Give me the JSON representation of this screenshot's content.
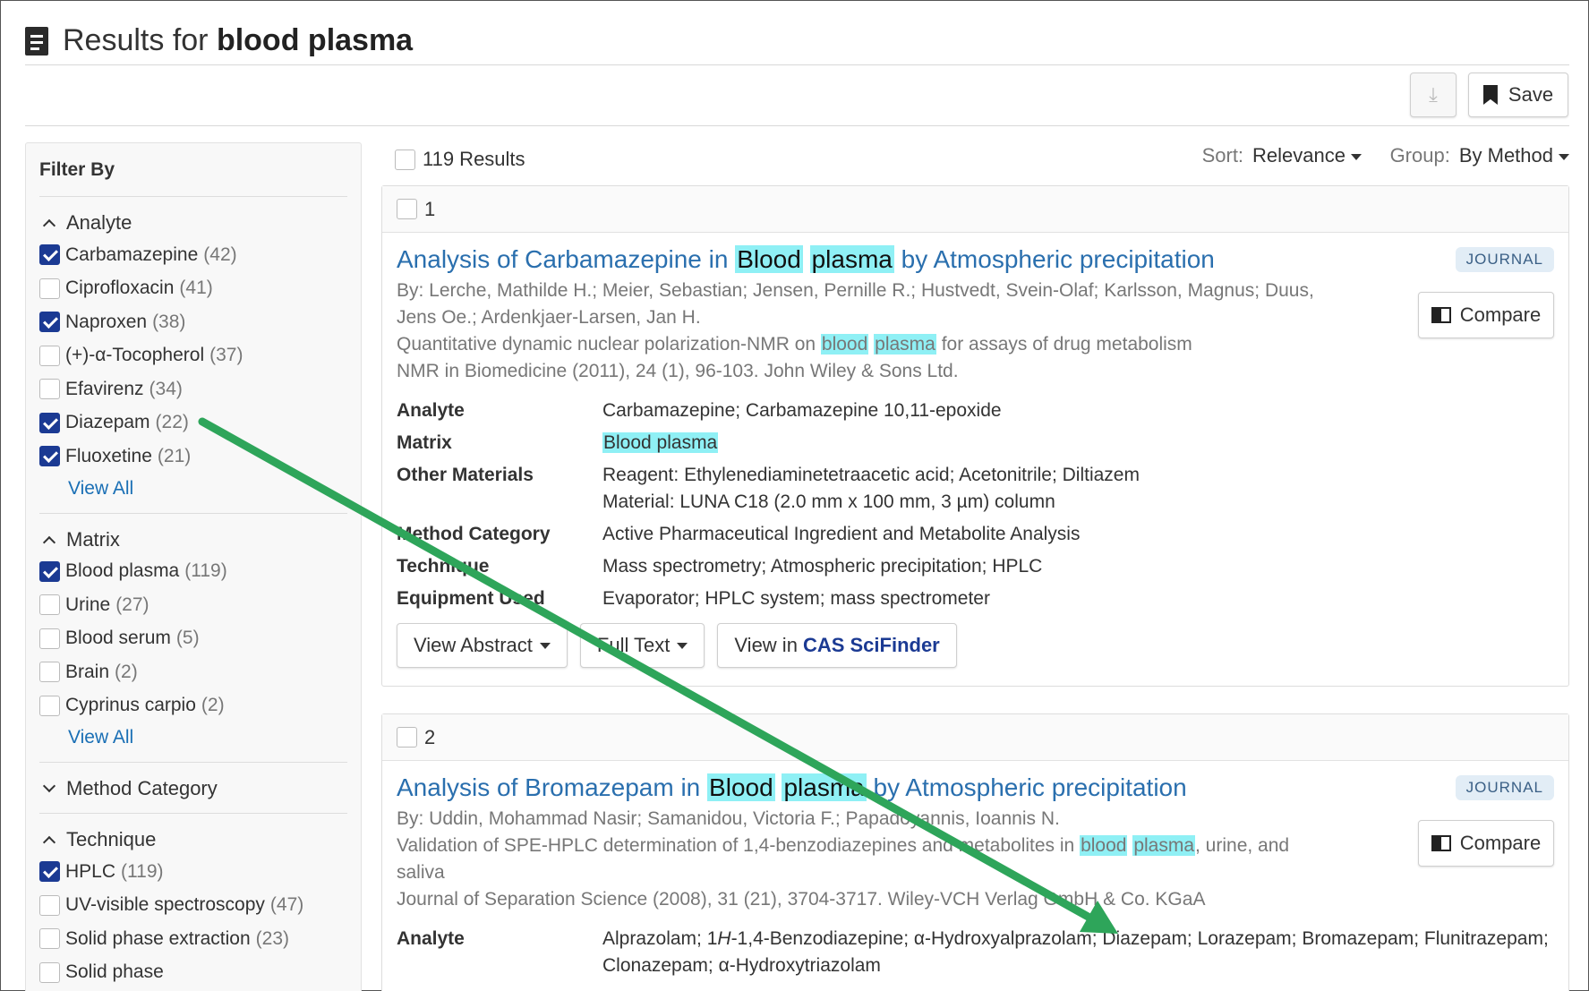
{
  "header": {
    "title_prefix": "Results for",
    "query": "blood plasma"
  },
  "toolbar": {
    "download_icon": "download-icon",
    "save_label": "Save"
  },
  "filter": {
    "title": "Filter By",
    "view_all_label": "View All",
    "analyte": {
      "label": "Analyte",
      "items": [
        {
          "name": "Carbamazepine",
          "count": "(42)",
          "checked": true
        },
        {
          "name": "Ciprofloxacin",
          "count": "(41)",
          "checked": false
        },
        {
          "name": "Naproxen",
          "count": "(38)",
          "checked": true
        },
        {
          "name": "(+)-α-Tocopherol",
          "count": "(37)",
          "checked": false
        },
        {
          "name": "Efavirenz",
          "count": "(34)",
          "checked": false
        },
        {
          "name": "Diazepam",
          "count": "(22)",
          "checked": true
        },
        {
          "name": "Fluoxetine",
          "count": "(21)",
          "checked": true
        }
      ]
    },
    "matrix": {
      "label": "Matrix",
      "items": [
        {
          "name": "Blood plasma",
          "count": "(119)",
          "checked": true
        },
        {
          "name": "Urine",
          "count": "(27)",
          "checked": false
        },
        {
          "name": "Blood serum",
          "count": "(5)",
          "checked": false
        },
        {
          "name": "Brain",
          "count": "(2)",
          "checked": false
        },
        {
          "name": "Cyprinus carpio",
          "count": "(2)",
          "checked": false
        }
      ]
    },
    "method_category": {
      "label": "Method Category"
    },
    "technique": {
      "label": "Technique",
      "items": [
        {
          "name": "HPLC",
          "count": "(119)",
          "checked": true
        },
        {
          "name": "UV-visible spectroscopy",
          "count": "(47)",
          "checked": false
        },
        {
          "name": "Solid phase extraction",
          "count": "(23)",
          "checked": false
        },
        {
          "name": "Solid phase",
          "count": "",
          "checked": false
        }
      ]
    }
  },
  "results_bar": {
    "count_label": "119 Results",
    "sort_label": "Sort:",
    "sort_value": "Relevance",
    "group_label": "Group:",
    "group_value": "By Method"
  },
  "results": [
    {
      "index": "1",
      "title_a": "Analysis of Carbamazepine in",
      "title_hl1": "Blood",
      "title_hl2": "plasma",
      "title_b": "by Atmospheric precipitation",
      "badge": "JOURNAL",
      "compare_label": "Compare",
      "authors": "By: Lerche, Mathilde H.; Meier, Sebastian; Jensen, Pernille R.; Hustvedt, Svein-Olaf; Karlsson, Magnus; Duus, Jens Oe.; Ardenkjaer-Larsen, Jan H.",
      "subtitle_a": "Quantitative dynamic nuclear polarization-NMR on",
      "subtitle_hl1": "blood",
      "subtitle_hl2": "plasma",
      "subtitle_b": "for assays of drug metabolism",
      "source": "NMR in Biomedicine (2011), 24 (1), 96-103. John Wiley & Sons Ltd.",
      "fields": {
        "analyte_label": "Analyte",
        "analyte": "Carbamazepine; Carbamazepine 10,11-epoxide",
        "matrix_label": "Matrix",
        "matrix": "Blood plasma",
        "other_label": "Other Materials",
        "other_1": "Reagent: Ethylenediaminetetraacetic acid; Acetonitrile; Diltiazem",
        "other_2": "Material: LUNA C18 (2.0 mm x 100 mm, 3 µm) column",
        "method_label": "Method Category",
        "method": "Active Pharmaceutical Ingredient and Metabolite Analysis",
        "technique_label": "Technique",
        "technique": "Mass spectrometry; Atmospheric precipitation; HPLC",
        "equipment_label": "Equipment Used",
        "equipment": "Evaporator; HPLC system; mass spectrometer"
      },
      "buttons": {
        "abstract": "View Abstract",
        "fulltext": "Full Text",
        "view_in": "View in",
        "cas": "CAS SciFinder"
      }
    },
    {
      "index": "2",
      "title_a": "Analysis of Bromazepam in",
      "title_hl1": "Blood",
      "title_hl2": "plasma",
      "title_b": "by Atmospheric precipitation",
      "badge": "JOURNAL",
      "compare_label": "Compare",
      "authors": "By: Uddin, Mohammad Nasir; Samanidou, Victoria F.; Papadoyannis, Ioannis N.",
      "subtitle_a": "Validation of SPE-HPLC determination of 1,4-benzodiazepines and metabolites in",
      "subtitle_hl1": "blood",
      "subtitle_hl2": "plasma",
      "subtitle_b": ", urine, and saliva",
      "source": "Journal of Separation Science (2008), 31 (21), 3704-3717. Wiley-VCH Verlag GmbH & Co. KGaA",
      "fields": {
        "analyte_label": "Analyte",
        "analyte_a": "Alprazolam; 1",
        "analyte_italic": "H",
        "analyte_b": "-1,4-Benzodiazepine; α-Hydroxyalprazolam; Diazepam; Lorazepam; Bromazepam; Flunitrazepam; Clonazepam; α-Hydroxytriazolam"
      }
    }
  ],
  "annotation": {
    "color": "#2ea55a"
  }
}
